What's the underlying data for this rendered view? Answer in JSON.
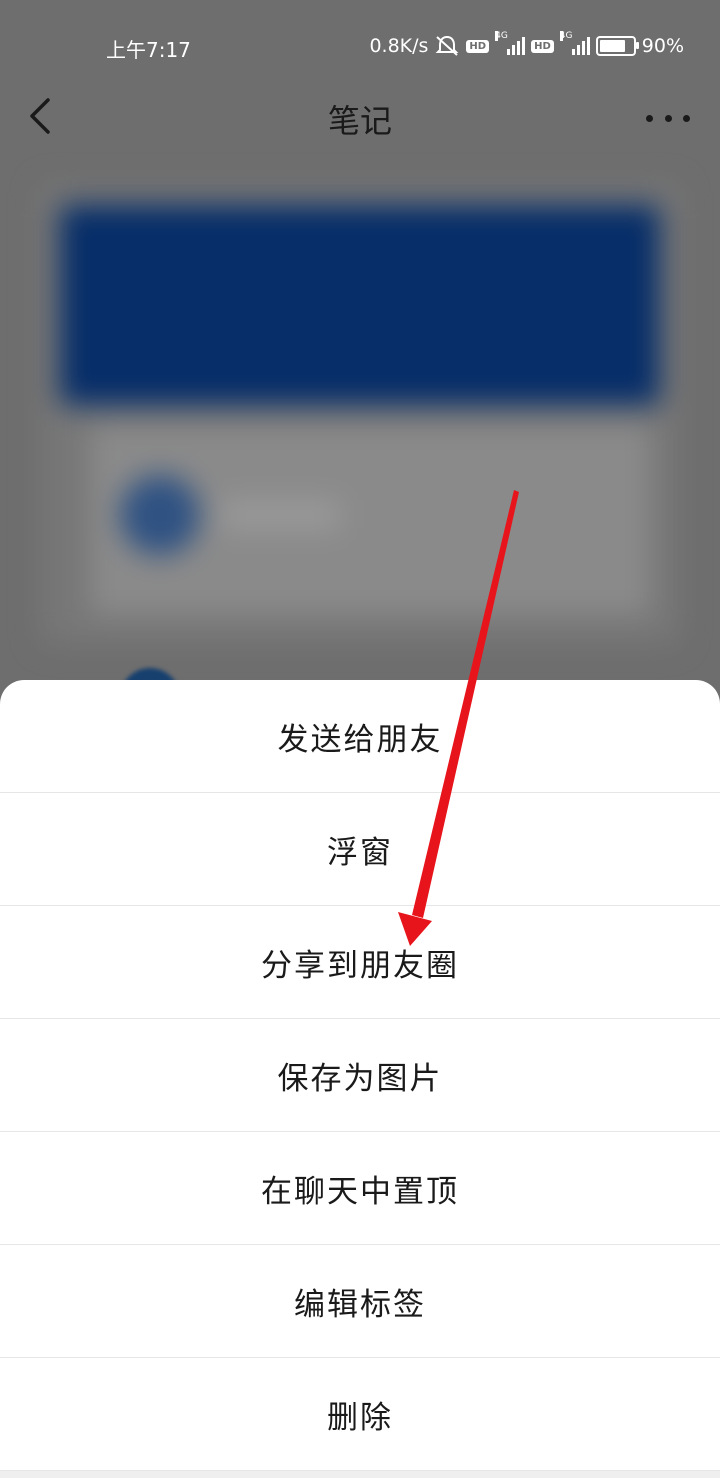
{
  "status_bar": {
    "time": "上午7:17",
    "net_speed": "0.8K/s",
    "hd_badge": "HD",
    "network": "4G",
    "battery": "90%",
    "battery_level": 0.9,
    "icons": [
      "mute-alarm-icon",
      "hd-icon",
      "signal-4g-icon",
      "battery-icon"
    ]
  },
  "nav": {
    "title": "笔记",
    "back_icon": "chevron-left-icon",
    "more_icon": "more-dots-icon"
  },
  "menu": {
    "items": [
      {
        "label": "发送给朋友"
      },
      {
        "label": "浮窗"
      },
      {
        "label": "分享到朋友圈"
      },
      {
        "label": "保存为图片"
      },
      {
        "label": "在聊天中置顶"
      },
      {
        "label": "编辑标签"
      },
      {
        "label": "删除"
      }
    ]
  },
  "colors": {
    "overlay": "#6e6e6e",
    "sheet": "#ffffff",
    "annotation_arrow": "#e8141b"
  }
}
